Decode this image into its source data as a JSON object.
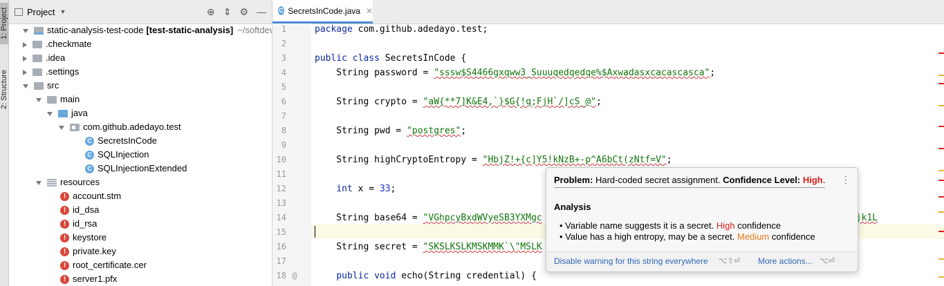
{
  "side_tabs": [
    "1: Project",
    "2: Structure"
  ],
  "project_panel": {
    "title": "Project",
    "tree": [
      {
        "label": "static-analysis-test-code",
        "suffix": "[test-static-analysis]",
        "path": "~/softdev",
        "type": "module",
        "expanded": true,
        "depth": 0
      },
      {
        "label": ".checkmate",
        "type": "folder",
        "expanded": false,
        "depth": 1
      },
      {
        "label": ".idea",
        "type": "folder",
        "expanded": false,
        "depth": 1
      },
      {
        "label": ".settings",
        "type": "folder",
        "expanded": false,
        "depth": 1
      },
      {
        "label": "src",
        "type": "folder",
        "expanded": true,
        "depth": 1
      },
      {
        "label": "main",
        "type": "folder",
        "expanded": true,
        "depth": 2
      },
      {
        "label": "java",
        "type": "source-folder",
        "expanded": true,
        "depth": 3
      },
      {
        "label": "com.github.adedayo.test",
        "type": "package",
        "expanded": true,
        "depth": 4
      },
      {
        "label": "SecretsInCode",
        "type": "class",
        "depth": 5
      },
      {
        "label": "SQLInjection",
        "type": "class",
        "depth": 5
      },
      {
        "label": "SQLInjectionExtended",
        "type": "class",
        "depth": 5
      },
      {
        "label": "resources",
        "type": "resources",
        "expanded": true,
        "depth": 3
      },
      {
        "label": "account.stm",
        "type": "error-file",
        "depth": 4
      },
      {
        "label": "id_dsa",
        "type": "error-file",
        "depth": 4
      },
      {
        "label": "id_rsa",
        "type": "error-file",
        "depth": 4
      },
      {
        "label": "keystore",
        "type": "error-file",
        "depth": 4
      },
      {
        "label": "private.key",
        "type": "error-file",
        "depth": 4
      },
      {
        "label": "root_certificate.cer",
        "type": "error-file",
        "depth": 4
      },
      {
        "label": "server1.pfx",
        "type": "error-file",
        "depth": 4
      }
    ]
  },
  "editor": {
    "tab": {
      "label": "SecretsInCode.java",
      "icon": "C"
    },
    "line_numbers": [
      "1",
      "2",
      "3",
      "4",
      "5",
      "6",
      "7",
      "8",
      "9",
      "10",
      "11",
      "12",
      "13",
      "14",
      "15",
      "16",
      "17",
      "18"
    ],
    "lines": [
      [
        {
          "t": "kw",
          "v": "package"
        },
        {
          "t": "var",
          "v": " com.github.adedayo.test;"
        }
      ],
      [],
      [
        {
          "t": "kw",
          "v": "public class"
        },
        {
          "t": "var",
          "v": " SecretsInCode {"
        }
      ],
      [
        {
          "t": "var",
          "v": "    String password = "
        },
        {
          "t": "str",
          "v": "\"sssw$S4466gxqww3_Suuuqedqedqe%$Axwadasxcacascasca\""
        },
        {
          "t": "var",
          "v": ";"
        }
      ],
      [],
      [
        {
          "t": "var",
          "v": "    String crypto = "
        },
        {
          "t": "str",
          "v": "\"aW{**7]K&E4,`}$G{!q;FjH`/]cS_@\""
        },
        {
          "t": "var",
          "v": ";"
        }
      ],
      [],
      [
        {
          "t": "var",
          "v": "    String pwd = "
        },
        {
          "t": "str",
          "v": "\"postgres\""
        },
        {
          "t": "var",
          "v": ";"
        }
      ],
      [],
      [
        {
          "t": "var",
          "v": "    String highCryptoEntropy = "
        },
        {
          "t": "str",
          "v": "\"HbjZ!+{c]Y5!kNzB+-p^A6bCt(zNtf=V\""
        },
        {
          "t": "var",
          "v": ";"
        }
      ],
      [],
      [
        {
          "t": "var",
          "v": "    "
        },
        {
          "t": "kw",
          "v": "int"
        },
        {
          "t": "var",
          "v": " x = "
        },
        {
          "t": "num",
          "v": "33"
        },
        {
          "t": "var",
          "v": ";"
        }
      ],
      [],
      [
        {
          "t": "var",
          "v": "    String base64 = "
        },
        {
          "t": "str",
          "v": "\"VGhpcyBxdWVyeSB3YXMgc"
        },
        {
          "t": "var",
          "v": "                                              "
        },
        {
          "t": "str",
          "v": "mVyc2lvbiAxLjk1L"
        }
      ],
      [],
      [
        {
          "t": "var",
          "v": "    String secret = "
        },
        {
          "t": "str",
          "v": "\"SKSLKSLKMSKMMK`\\\"MSLK"
        }
      ],
      [],
      [
        {
          "t": "var",
          "v": "    "
        },
        {
          "t": "kw",
          "v": "public void"
        },
        {
          "t": "var",
          "v": " echo(String credential) {"
        }
      ]
    ],
    "gutter_marker_line18": "@"
  },
  "popup": {
    "problem_label": "Problem:",
    "problem_text": "Hard-coded secret assignment.",
    "confidence_label": "Confidence Level:",
    "confidence_value": "High",
    "period": ".",
    "analysis_title": "Analysis",
    "bullets": [
      {
        "text": "Variable name suggests it is a secret.",
        "level": "High",
        "suffix": "confidence"
      },
      {
        "text": "Value has a high entropy, may be a secret.",
        "level": "Medium",
        "suffix": "confidence"
      }
    ],
    "action1": "Disable warning for this string everywhere",
    "action1_shortcut": "⌥⇧⏎",
    "action2": "More actions...",
    "action2_shortcut": "⌥⏎"
  },
  "colors": {
    "accent": "#4a8ad5",
    "keyword": "#0a28a0",
    "string": "#11740a",
    "error": "#d82020",
    "medium": "#e27b1a",
    "link": "#2f68b5"
  }
}
